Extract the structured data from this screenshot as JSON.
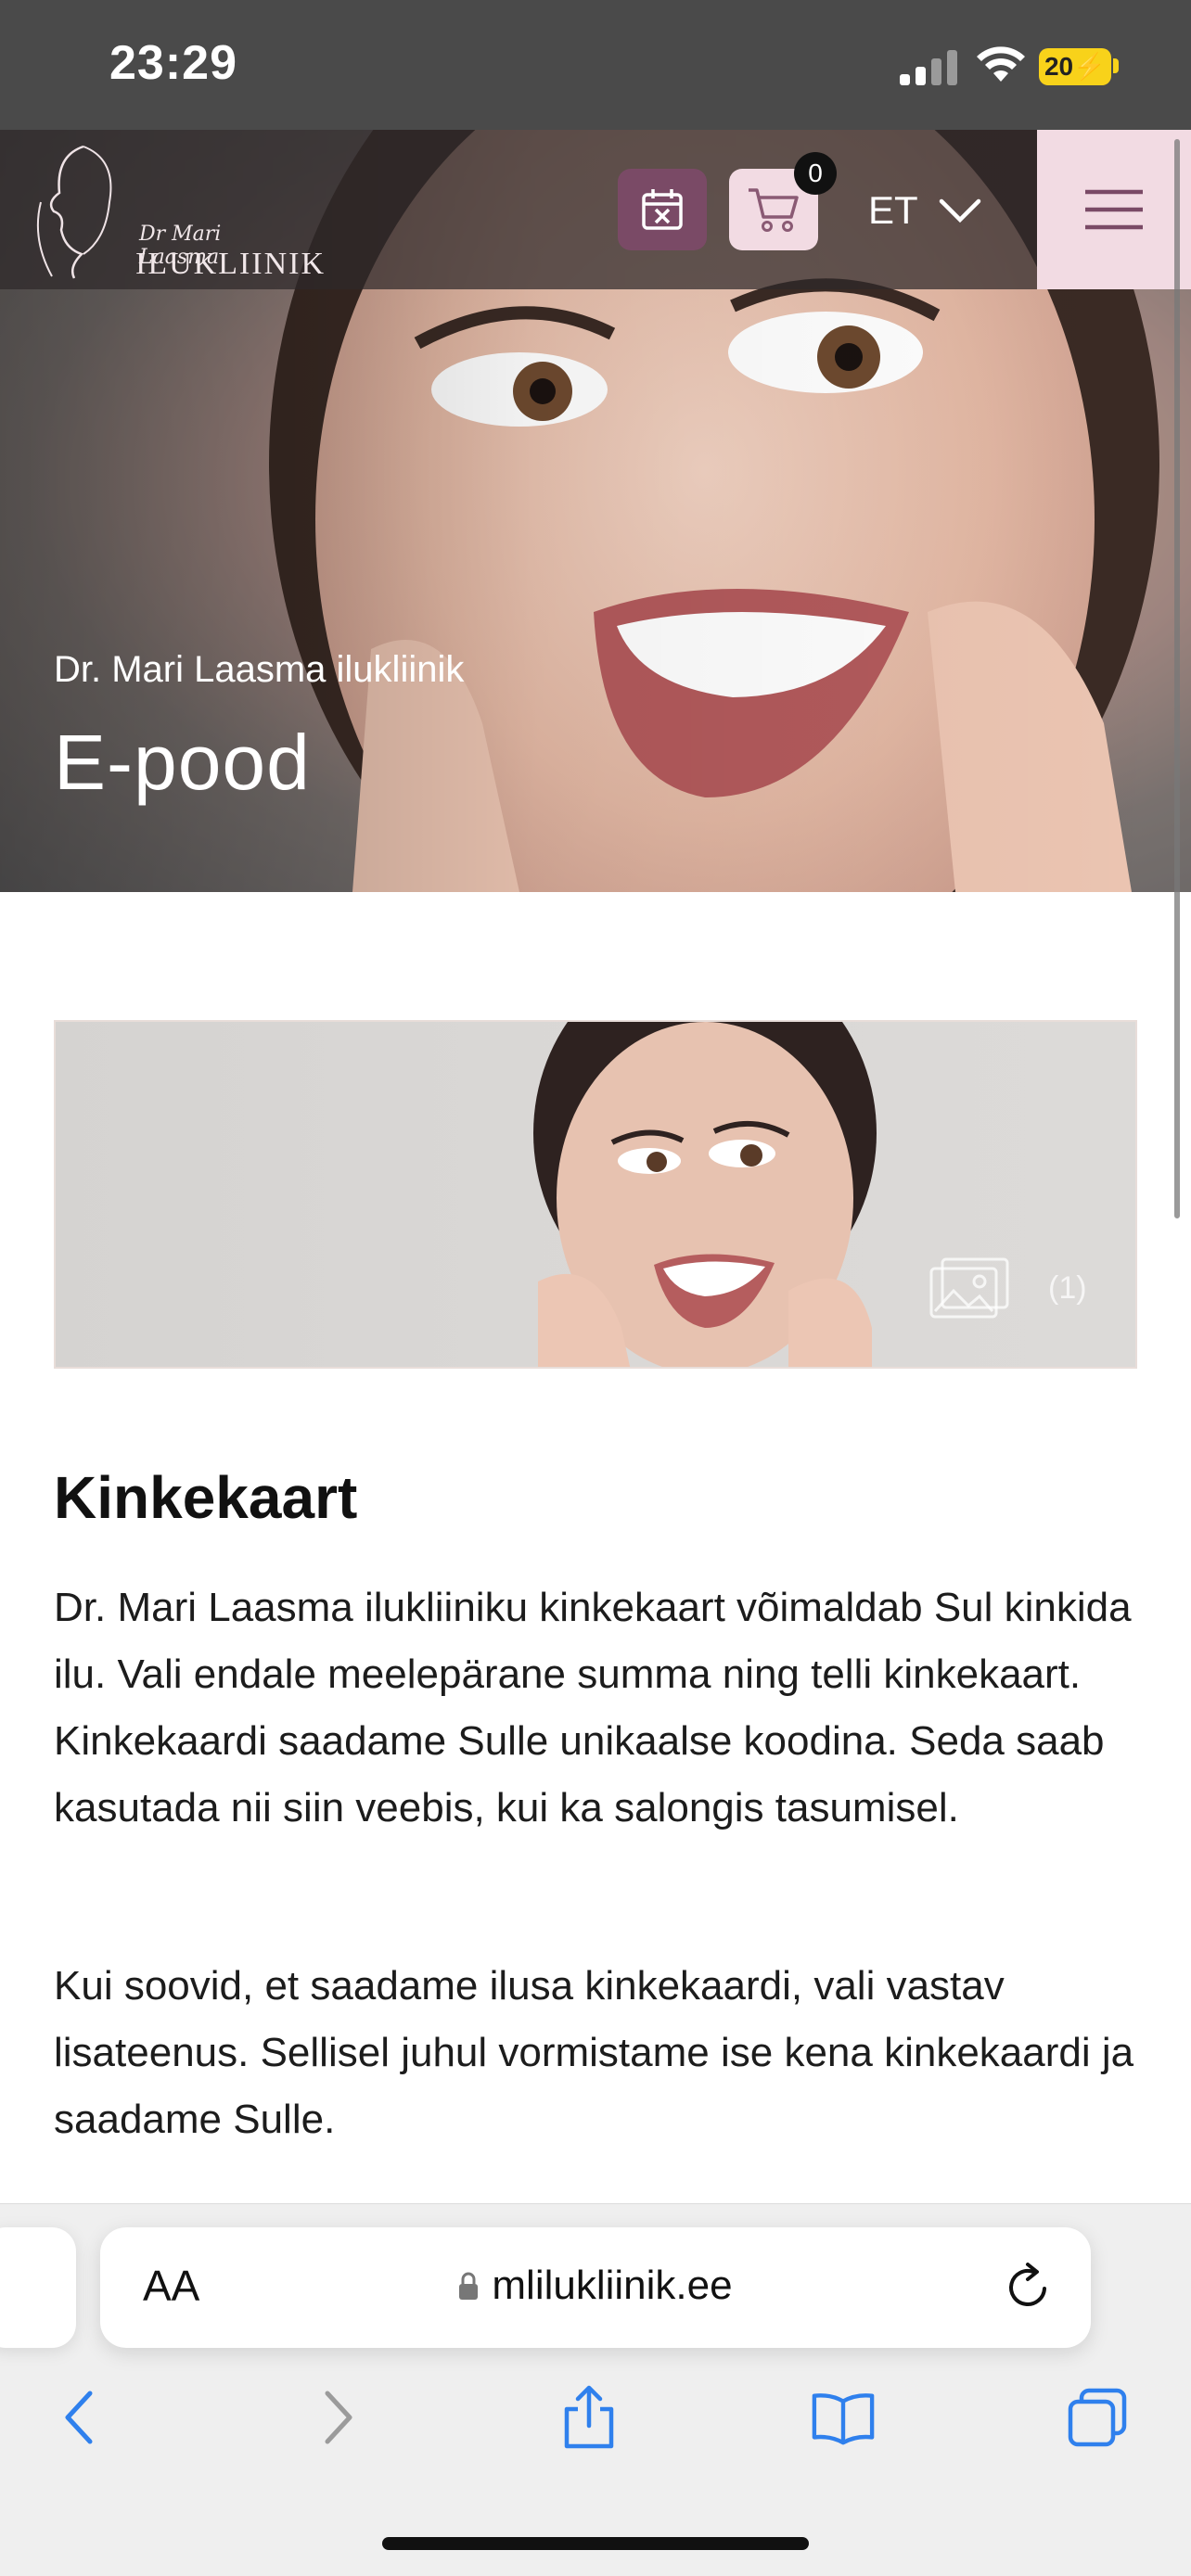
{
  "status_bar": {
    "time": "23:29",
    "battery": "20",
    "icons": [
      "signal-icon",
      "wifi-icon",
      "battery-charging-icon"
    ]
  },
  "header": {
    "logo_script": "Dr Mari Laasma",
    "logo_name": "ILUKLIINIK",
    "cart_count": "0",
    "language": "ET",
    "icons": [
      "calendar-icon",
      "cart-icon",
      "chevron-down-icon",
      "hamburger-menu-icon"
    ],
    "colors": {
      "booking_bg": "#7a4a66",
      "accent_light": "#f2dbe3"
    }
  },
  "hero": {
    "subtitle": "Dr. Mari Laasma ilukliinik",
    "title": "E-pood"
  },
  "product": {
    "image_count": "(1)",
    "heading": "Kinkekaart",
    "description": [
      "Dr. Mari Laasma ilukliiniku kinkekaart võimaldab Sul kinkida ilu. Vali endale meelepärane summa ning telli kinkekaart. Kinkekaardi saadame Sulle unikaalse koodina. Seda saab kasutada nii siin veebis, kui ka salongis tasumisel.",
      "Kui soovid, et saadame ilusa kinkekaardi, vali vastav lisateenus. Sellisel juhul vormistame ise kena kinkekaardi ja saadame Sulle."
    ]
  },
  "browser": {
    "text_size_label": "AA",
    "url": "mlilukliinik.ee",
    "toolbar_icons": [
      "back-icon",
      "forward-icon",
      "share-icon",
      "bookmarks-icon",
      "tabs-icon"
    ]
  }
}
